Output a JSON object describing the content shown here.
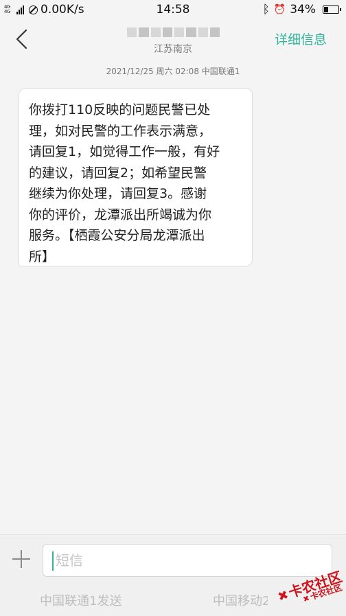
{
  "status_bar": {
    "network_type": "4G 4G",
    "speed": "0.00K/s",
    "time": "14:58",
    "bluetooth_icon": "ᛒ",
    "alarm_icon": "⏰",
    "battery_percent": "34%",
    "battery_level": 0.34
  },
  "header": {
    "location": "江苏南京",
    "detail_label": "详细信息"
  },
  "conversation": {
    "timestamp": "2021/12/25 周六  02:08  中国联通1",
    "message_lines": [
      "你拨打110反映的问题民警已处",
      "理，如对民警的工作表示满意，",
      "请回复1，如觉得工作一般，有好",
      "的建议，请回复2；如希望民警",
      "继续为你处理，请回复3。感谢",
      "你的评价，龙潭派出所竭诚为你",
      "服务。【栖霞公安分局龙潭派出",
      "所】"
    ]
  },
  "composer": {
    "placeholder": "短信",
    "send_sim1": "中国联通1发送",
    "send_sim2": "中国移动2发送"
  },
  "watermark": {
    "text_large": "卡农社区",
    "text_small": "卡农社区"
  },
  "colors": {
    "accent": "#2fb39b",
    "watermark": "#d0121b"
  }
}
